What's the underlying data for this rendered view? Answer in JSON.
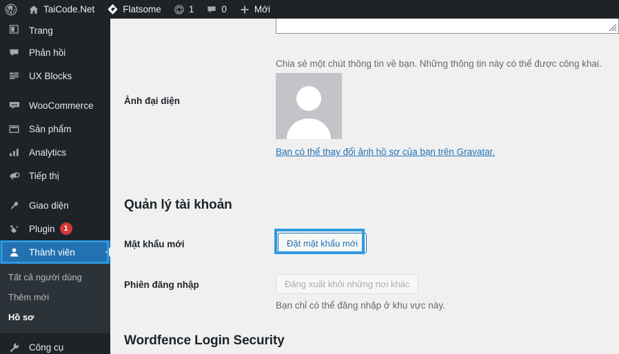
{
  "adminbar": {
    "items": [
      {
        "icon": "wordpress-logo-icon",
        "label": ""
      },
      {
        "icon": "home-icon",
        "label": "TaiCode.Net"
      },
      {
        "icon": "flatsome-icon",
        "label": "Flatsome"
      },
      {
        "icon": "updates-icon",
        "label": "1"
      },
      {
        "icon": "comments-icon",
        "label": "0"
      },
      {
        "icon": "plus-icon",
        "label": "Mới"
      }
    ]
  },
  "sidebar": {
    "items": [
      {
        "name": "pages",
        "icon": "pages-icon",
        "label": "Trang",
        "badge": ""
      },
      {
        "name": "comments",
        "icon": "comments-icon",
        "label": "Phản hồi",
        "badge": ""
      },
      {
        "name": "ux-blocks",
        "icon": "ux-blocks-icon",
        "label": "UX Blocks",
        "badge": ""
      },
      {
        "name": "woocommerce",
        "icon": "woocommerce-icon",
        "label": "WooCommerce",
        "badge": ""
      },
      {
        "name": "products",
        "icon": "products-icon",
        "label": "Sản phẩm",
        "badge": ""
      },
      {
        "name": "analytics",
        "icon": "analytics-icon",
        "label": "Analytics",
        "badge": ""
      },
      {
        "name": "marketing",
        "icon": "marketing-icon",
        "label": "Tiếp thị",
        "badge": ""
      },
      {
        "name": "appearance",
        "icon": "appearance-icon",
        "label": "Giao diện",
        "badge": ""
      },
      {
        "name": "plugins",
        "icon": "plugins-icon",
        "label": "Plugin",
        "badge": "1"
      },
      {
        "name": "users",
        "icon": "users-icon",
        "label": "Thành viên",
        "badge": ""
      },
      {
        "name": "tools",
        "icon": "tools-icon",
        "label": "Công cụ",
        "badge": ""
      }
    ],
    "submenu": [
      {
        "name": "all-users",
        "label": "Tất cả người dùng",
        "current": false
      },
      {
        "name": "add-new",
        "label": "Thêm mới",
        "current": false
      },
      {
        "name": "profile",
        "label": "Hồ sơ",
        "current": true
      }
    ]
  },
  "content": {
    "bio_help": "Chia sẻ một chút thông tin về bạn. Những thông tin này có thể được công khai.",
    "avatar_label": "Ảnh đại diện",
    "gravatar_link": "Bạn có thể thay đổi ảnh hồ sơ của bạn trên Gravatar.",
    "account_section_title": "Quản lý tài khoản",
    "new_password_label": "Mật khẩu mới",
    "set_new_password_button": "Đặt mật khẩu mới",
    "sessions_label": "Phiên đăng nhập",
    "logout_everywhere_button": "Đăng xuất khỏi những nơi khác",
    "sessions_note": "Bạn chỉ có thể đăng nhập ở khu vực này.",
    "wordfence_section_title": "Wordfence Login Security"
  },
  "colors": {
    "admin_dark": "#1d2327",
    "submenu_dark": "#2c3338",
    "accent_blue": "#2271b1",
    "focus_blue": "#2d9ae0",
    "badge_red": "#d63638",
    "content_bg": "#f0f0f1",
    "link_blue": "#2271b1"
  }
}
